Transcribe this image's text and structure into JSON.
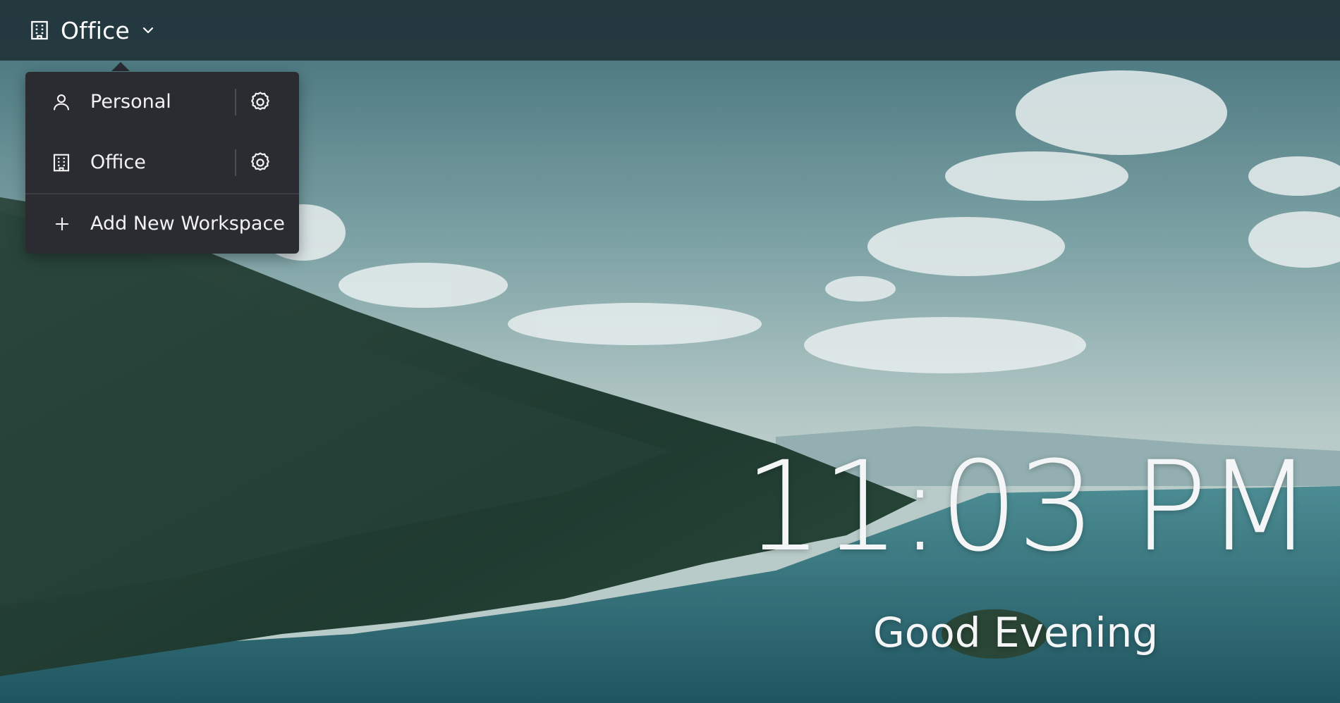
{
  "topbar": {
    "workspace_icon": "building-icon",
    "current_workspace": "Office",
    "chevron_icon": "chevron-down-icon"
  },
  "dropdown": {
    "items": [
      {
        "label": "Personal",
        "icon": "user-icon",
        "settings_icon": "gear-icon"
      },
      {
        "label": "Office",
        "icon": "building-icon",
        "settings_icon": "gear-icon"
      }
    ],
    "add": {
      "label": "Add New Workspace",
      "icon": "plus-icon"
    }
  },
  "clock": {
    "time": "11:03 PM",
    "greeting": "Good Evening"
  },
  "colors": {
    "topbar_bg": "#22343a",
    "dropdown_bg": "#2a2c31",
    "text": "#f2f2f2"
  }
}
